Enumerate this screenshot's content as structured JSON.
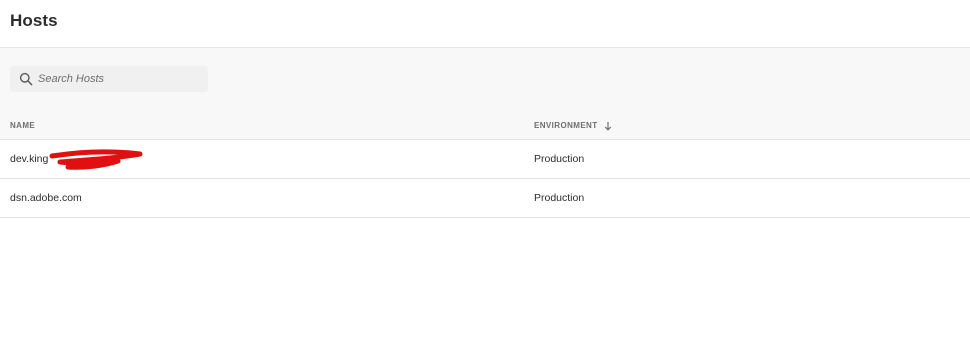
{
  "header": {
    "title": "Hosts"
  },
  "search": {
    "placeholder": "Search Hosts",
    "value": "",
    "icon": "search-icon"
  },
  "table": {
    "columns": [
      {
        "label": "NAME"
      },
      {
        "label": "ENVIRONMENT",
        "sort": "descending",
        "sort_icon": "arrow-down-icon"
      }
    ],
    "rows": [
      {
        "name": "dev.king",
        "environment": "Production",
        "redacted": true
      },
      {
        "name": "dsn.adobe.com",
        "environment": "Production"
      }
    ]
  },
  "colors": {
    "redaction": "#e01010",
    "toolbar_bg": "#f8f8f8",
    "divider": "#e1e1e1"
  }
}
